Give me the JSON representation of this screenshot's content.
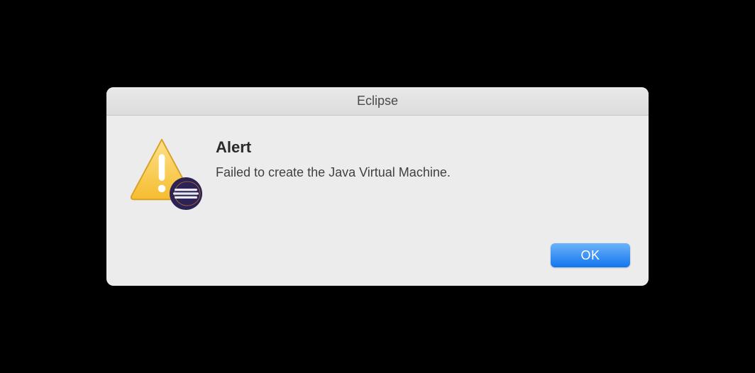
{
  "dialog": {
    "title": "Eclipse",
    "alert_heading": "Alert",
    "alert_message": "Failed to create the Java Virtual Machine.",
    "ok_label": "OK"
  },
  "icons": {
    "warning": "warning-triangle-icon",
    "app_badge": "eclipse-icon"
  },
  "colors": {
    "warning_fill": "#f7c948",
    "warning_stroke": "#d8a127",
    "eclipse_bg": "#2c2255",
    "button_primary": "#1275ee"
  }
}
